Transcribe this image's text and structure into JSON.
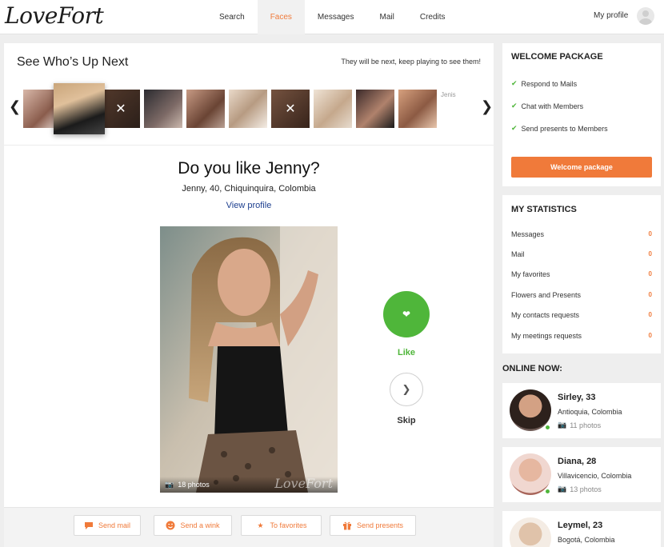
{
  "brand": {
    "logo": "LoveFort",
    "accent": "#f07a3a",
    "like_color": "#4fb63a"
  },
  "nav": {
    "items": [
      "Search",
      "Faces",
      "Messages",
      "Mail",
      "Credits"
    ],
    "active": "Faces",
    "profile": "My profile"
  },
  "next": {
    "title": "See Who’s Up Next",
    "hint": "They will be next, keep playing to see them!",
    "broken_alt": "Jenis",
    "thumbs_note": "10 thumbnails, 2nd highlighted, 3rd and 6th marked skipped, last failed to load"
  },
  "profile": {
    "question": "Do you like Jenny?",
    "details": "Jenny, 40, Chiquinquira, Colombia",
    "view_profile": "View profile",
    "photos": "18 photos",
    "watermark": "LoveFort"
  },
  "vote": {
    "like": "Like",
    "skip": "Skip"
  },
  "actions": [
    "Send mail",
    "Send a wink",
    "To favorites",
    "Send presents"
  ],
  "welcome": {
    "title": "WELCOME PACKAGE",
    "items": [
      "Respond to Mails",
      "Chat with Members",
      "Send presents to Members"
    ],
    "button": "Welcome package"
  },
  "stats": {
    "title": "MY STATISTICS",
    "rows": [
      {
        "label": "Messages",
        "value": "0"
      },
      {
        "label": "Mail",
        "value": "0"
      },
      {
        "label": "My favorites",
        "value": "0"
      },
      {
        "label": "Flowers and Presents",
        "value": "0"
      },
      {
        "label": "My contacts requests",
        "value": "0"
      },
      {
        "label": "My meetings requests",
        "value": "0"
      }
    ]
  },
  "online": {
    "title": "ONLINE NOW:",
    "members": [
      {
        "name": "Sirley, 33",
        "location": "Antioquia, Colombia",
        "photos": "11 photos"
      },
      {
        "name": "Diana, 28",
        "location": "Villavicencio, Colombia",
        "photos": "13 photos"
      },
      {
        "name": "Leymel, 23",
        "location": "Bogotá, Colombia"
      }
    ]
  }
}
